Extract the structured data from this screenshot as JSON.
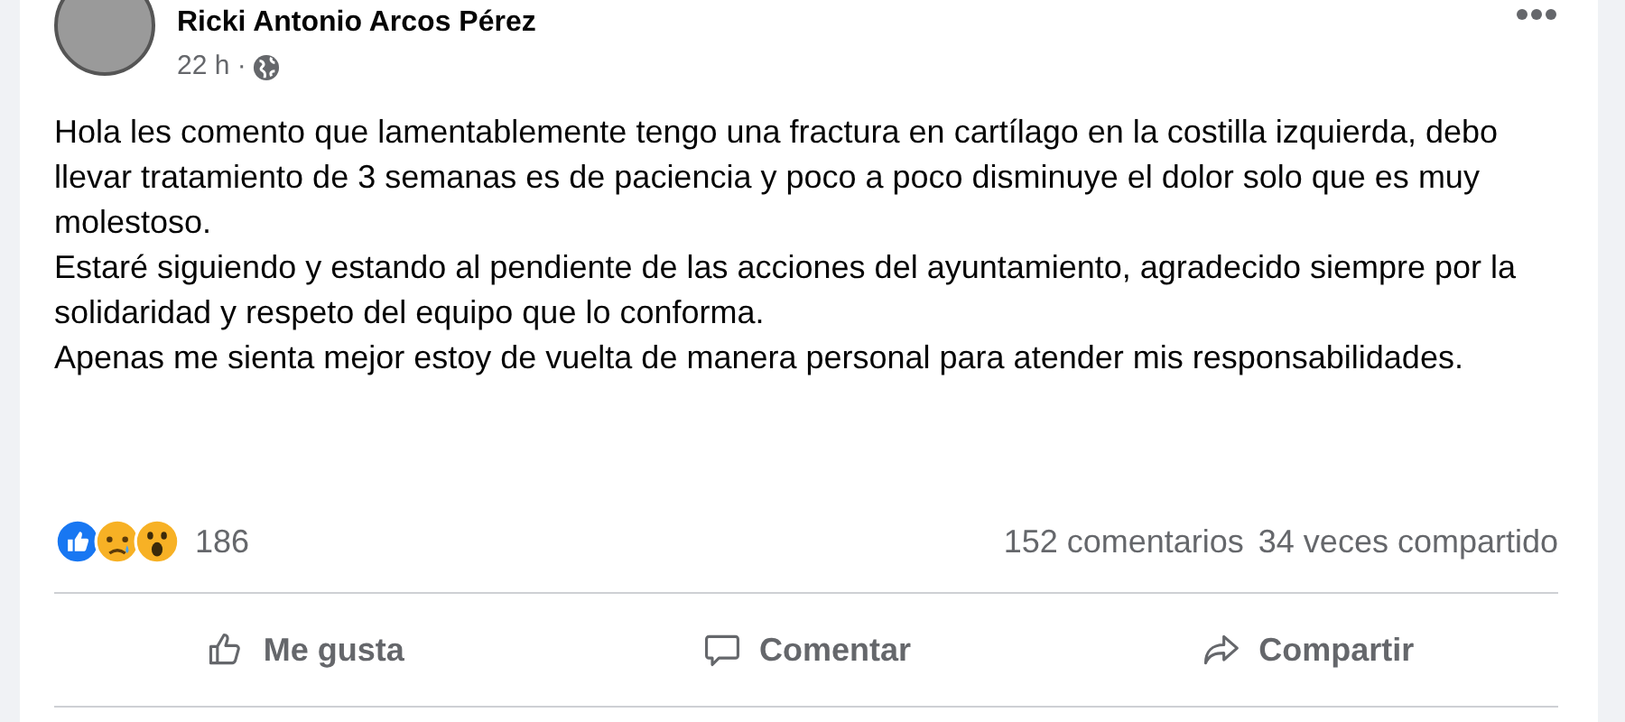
{
  "post": {
    "author": "Ricki Antonio Arcos Pérez",
    "time": "22 h ·",
    "body": [
      "Hola les comento que lamentablemente tengo una fractura en cartílago en la costilla izquierda, debo llevar tratamiento de 3 semanas es de paciencia y poco a poco disminuye el dolor solo que es muy molestoso.",
      "Estaré siguiendo y estando al pendiente de las acciones del ayuntamiento, agradecido siempre por la solidaridad y respeto del equipo que lo conforma.",
      "Apenas me sienta mejor estoy de vuelta de manera personal para atender mis responsabilidades."
    ]
  },
  "reactions": {
    "kinds": [
      {
        "kind": "like"
      },
      {
        "kind": "sad"
      },
      {
        "kind": "wow"
      }
    ],
    "count": "186",
    "comments": "152 comentarios",
    "shares": "34 veces compartido"
  },
  "actions": [
    {
      "kind": "like",
      "label": "Me gusta"
    },
    {
      "kind": "comment",
      "label": "Comentar"
    },
    {
      "kind": "share",
      "label": "Compartir"
    }
  ]
}
